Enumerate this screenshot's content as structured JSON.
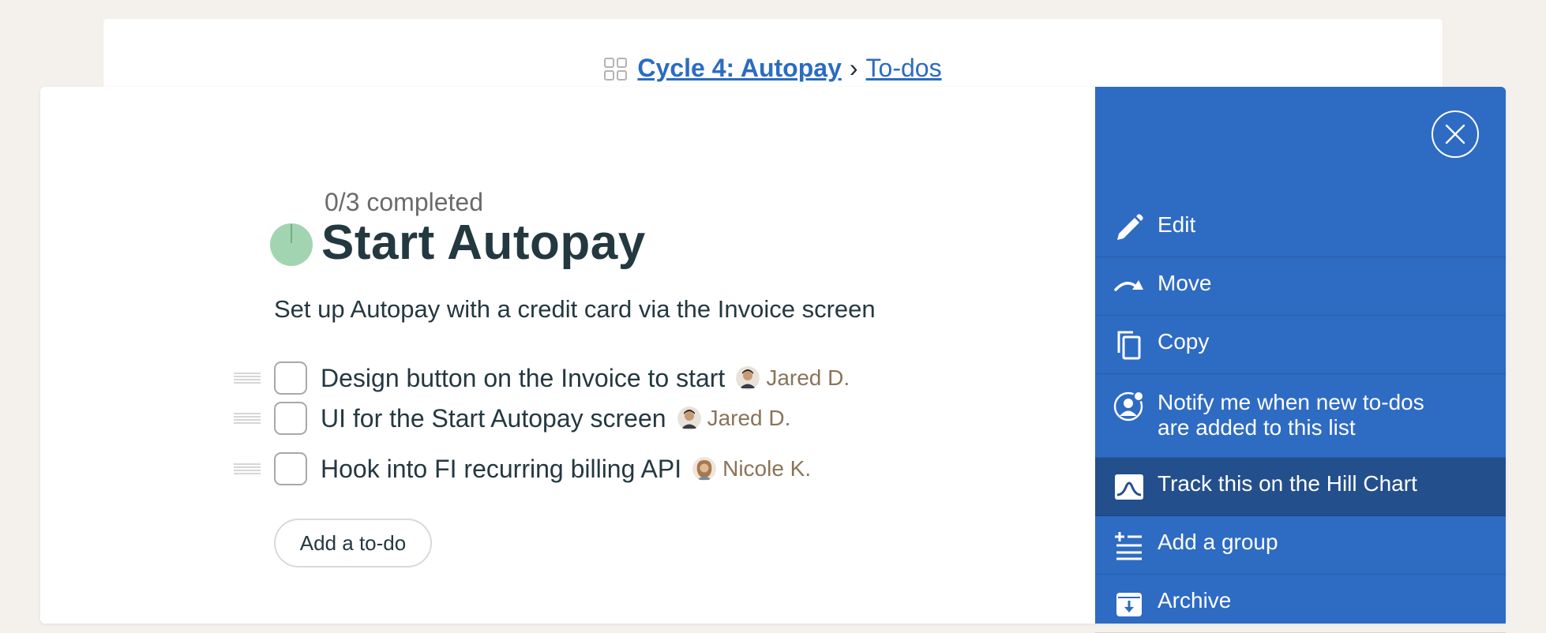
{
  "breadcrumb": {
    "project": "Cycle 4: Autopay",
    "separator": "›",
    "section": "To-dos"
  },
  "list": {
    "progress_text": "0/3 completed",
    "completed": 0,
    "total": 3,
    "title": "Start Autopay",
    "description": "Set up Autopay with a credit card via the Invoice screen",
    "todos": [
      {
        "text": "Design button on the Invoice to start",
        "assignee": "Jared D.",
        "checked": false
      },
      {
        "text": "UI for the Start Autopay screen",
        "assignee": "Jared D.",
        "checked": false
      },
      {
        "text": "Hook into FI recurring billing API",
        "assignee": "Nicole K.",
        "checked": false
      }
    ],
    "add_button": "Add a to-do"
  },
  "menu": {
    "items": [
      {
        "label": "Edit",
        "icon": "pencil-icon"
      },
      {
        "label": "Move",
        "icon": "move-arrow-icon"
      },
      {
        "label": "Copy",
        "icon": "copy-icon"
      },
      {
        "label": "Notify me when new to-dos are added to this list",
        "icon": "notify-icon"
      },
      {
        "label": "Track this on the Hill Chart",
        "icon": "hill-chart-icon",
        "active": true
      },
      {
        "label": "Add a group",
        "icon": "add-group-icon"
      },
      {
        "label": "Archive",
        "icon": "archive-icon"
      }
    ]
  },
  "colors": {
    "menu_bg": "#2e6bc3",
    "menu_active": "#244f8d",
    "link": "#2b6cc0",
    "progress": "#a3d4b1",
    "assignee": "#8a7458"
  }
}
